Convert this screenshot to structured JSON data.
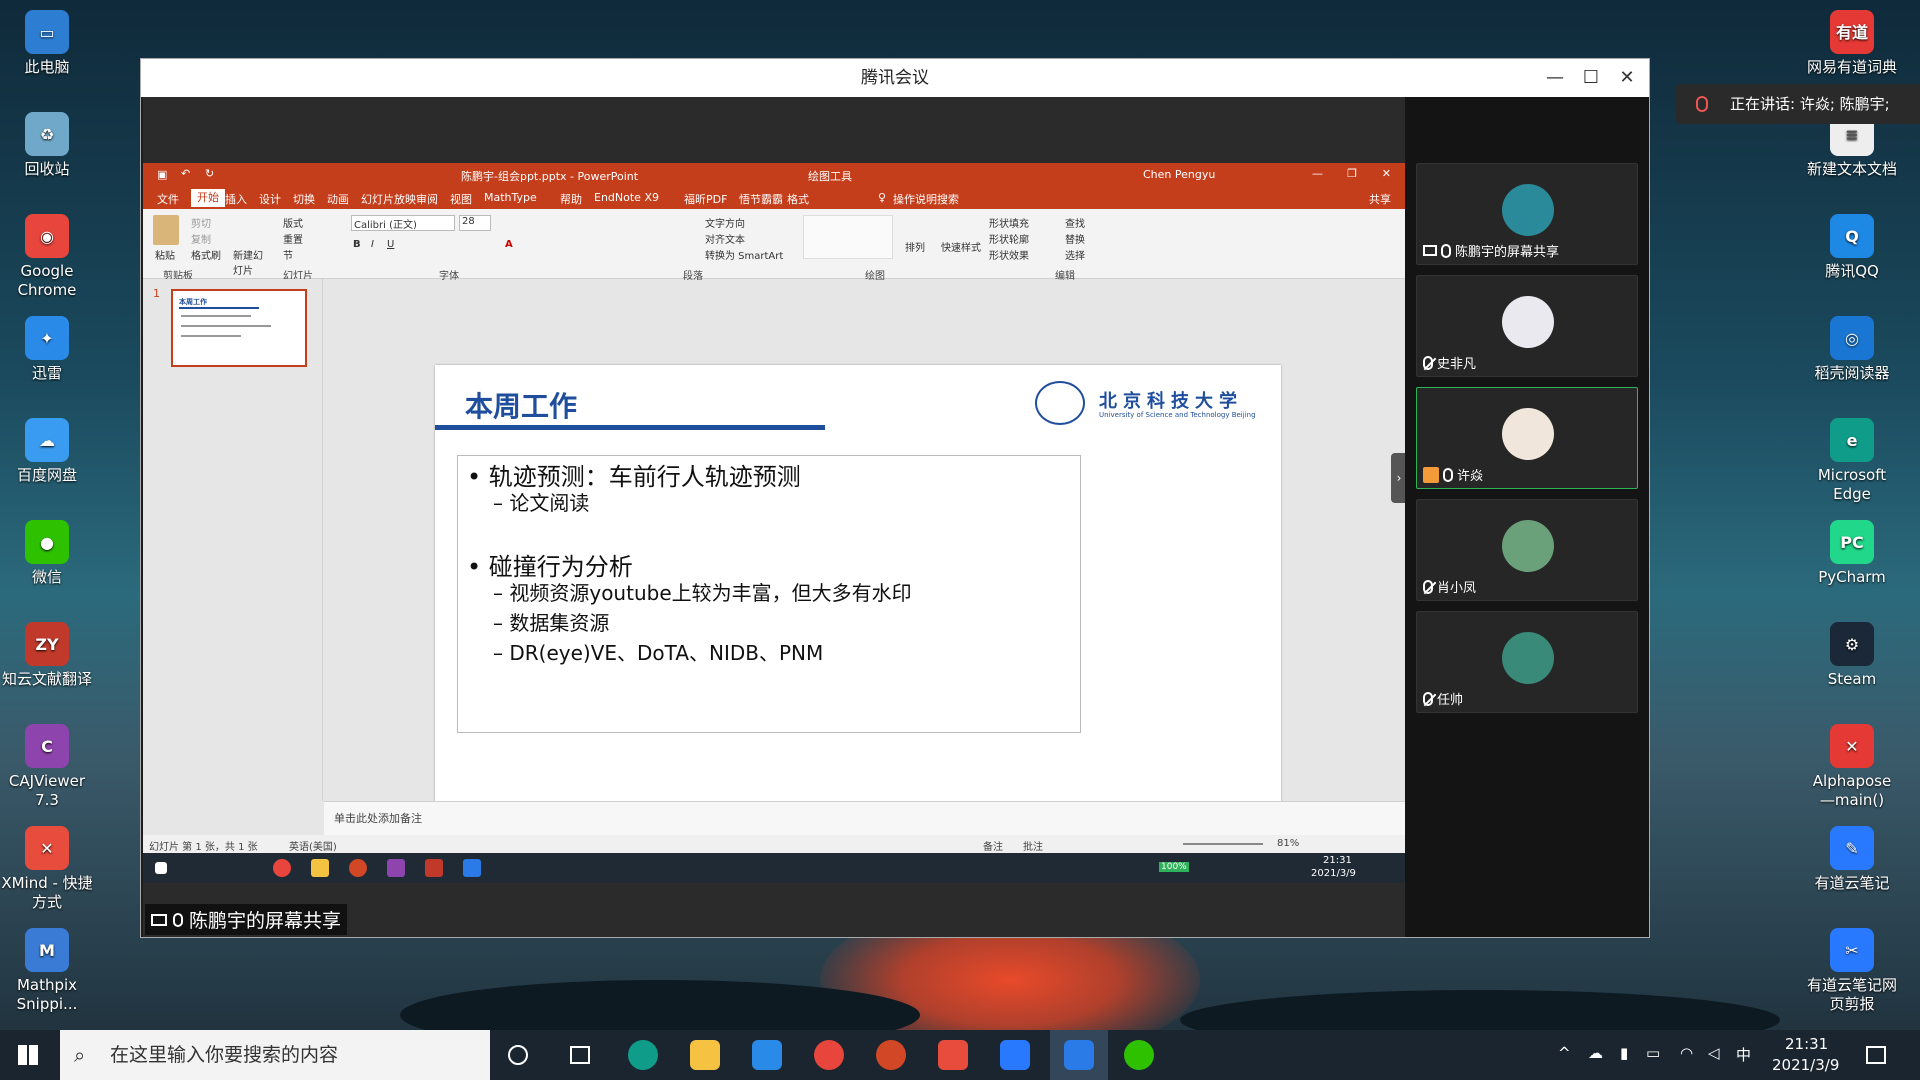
{
  "desktop": {
    "left_icons": [
      {
        "label": "此电脑",
        "color": "#2d7dd2",
        "glyph": "▭"
      },
      {
        "label": "回收站",
        "color": "#6fa8c8",
        "glyph": "♻"
      },
      {
        "label": "Google Chrome",
        "color": "#e8453c",
        "glyph": "◉"
      },
      {
        "label": "迅雷",
        "color": "#2a8ae8",
        "glyph": "✦"
      },
      {
        "label": "百度网盘",
        "color": "#3a9cf0",
        "glyph": "☁"
      },
      {
        "label": "微信",
        "color": "#2dc100",
        "glyph": "●"
      },
      {
        "label": "知云文献翻译",
        "color": "#c0392b",
        "glyph": "ZY"
      },
      {
        "label": "CAJViewer 7.3",
        "color": "#8e44ad",
        "glyph": "C"
      },
      {
        "label": "XMind - 快捷方式",
        "color": "#e74c3c",
        "glyph": "✕"
      },
      {
        "label": "Mathpix Snippi...",
        "color": "#3a7bd5",
        "glyph": "M"
      }
    ],
    "right_icons": [
      {
        "label": "网易有道词典",
        "color": "#e53935",
        "glyph": "有道"
      },
      {
        "label": "新建文本文档",
        "color": "#eeeeee",
        "glyph": "≡"
      },
      {
        "label": "腾讯QQ",
        "color": "#1e88e5",
        "glyph": "Q"
      },
      {
        "label": "稻壳阅读器",
        "color": "#1976d2",
        "glyph": "◎"
      },
      {
        "label": "Microsoft Edge",
        "color": "#0f9d8a",
        "glyph": "e"
      },
      {
        "label": "PyCharm",
        "color": "#21d789",
        "glyph": "PC"
      },
      {
        "label": "Steam",
        "color": "#1b2838",
        "glyph": "⚙"
      },
      {
        "label": "Alphapose —main()",
        "color": "#e53935",
        "glyph": "✕"
      },
      {
        "label": "有道云笔记",
        "color": "#2979ff",
        "glyph": "✎"
      },
      {
        "label": "有道云笔记网页剪报",
        "color": "#2979ff",
        "glyph": "✂"
      }
    ]
  },
  "speaking_banner": "正在讲话: 许焱; 陈鹏宇;",
  "meeting": {
    "title": "腾讯会议",
    "share_label": "陈鹏宇的屏幕共享",
    "participants": [
      {
        "name": "陈鹏宇的屏幕共享",
        "mic": "on",
        "share": true,
        "color": "#2a8a9a"
      },
      {
        "name": "史非凡",
        "mic": "off",
        "share": false,
        "color": "#e9e9ef"
      },
      {
        "name": "许焱",
        "mic": "on",
        "share": false,
        "active": true,
        "color": "#f0e6dc"
      },
      {
        "name": "肖小凤",
        "mic": "off",
        "share": false,
        "color": "#6aa07a"
      },
      {
        "name": "任帅",
        "mic": "off",
        "share": false,
        "color": "#3a8a7a"
      }
    ]
  },
  "ppt": {
    "filename": "陈鹏宇-组会ppt.pptx - PowerPoint",
    "context_tool": "绘图工具",
    "user": "Chen Pengyu",
    "tabs": [
      "文件",
      "开始",
      "插入",
      "设计",
      "切换",
      "动画",
      "幻灯片放映",
      "审阅",
      "视图",
      "MathType",
      "帮助",
      "EndNote X9",
      "福昕PDF",
      "悟节霸霸",
      "格式"
    ],
    "tell_me": "操作说明搜索",
    "share_btn": "共享",
    "font_name": "Calibri (正文)",
    "font_size": "28",
    "groups": [
      "剪贴板",
      "幻灯片",
      "字体",
      "段落",
      "绘图",
      "编辑"
    ],
    "ribbon_items": {
      "paste": "粘贴",
      "cut": "剪切",
      "copy": "复制",
      "format_painter": "格式刷",
      "new_slide": "新建幻灯片",
      "layout": "版式",
      "reset": "重置",
      "section": "节",
      "text_direction": "文字方向",
      "align_text": "对齐文本",
      "smartart": "转换为 SmartArt",
      "arrange": "排列",
      "quick_styles": "快速样式",
      "shape_fill": "形状填充",
      "shape_outline": "形状轮廓",
      "shape_effects": "形状效果",
      "find": "查找",
      "replace": "替换",
      "select": "选择"
    },
    "slide": {
      "title": "本周工作",
      "logo_cn": "北京科技大学",
      "logo_en": "University of Science and Technology Beijing",
      "bullets": [
        {
          "level": 1,
          "text": "轨迹预测：车前行人轨迹预测"
        },
        {
          "level": 2,
          "text": "论文阅读"
        },
        {
          "level": 0,
          "text": ""
        },
        {
          "level": 1,
          "text": "碰撞行为分析"
        },
        {
          "level": 2,
          "text": "视频资源youtube上较为丰富，但大多有水印"
        },
        {
          "level": 2,
          "text": "数据集资源"
        },
        {
          "level": 2,
          "text": "DR(eye)VE、DoTA、NIDB、PNM"
        }
      ],
      "page_number": "1"
    },
    "thumb_number": "1",
    "notes_placeholder": "单击此处添加备注",
    "status_left": "幻灯片 第 1 张，共 1 张",
    "status_lang": "英语(美国)",
    "status_notes": "备注",
    "status_comments": "批注",
    "zoom": "81%",
    "inner_time": "21:31",
    "inner_date": "2021/3/9",
    "battery": "100%"
  },
  "taskbar": {
    "search_placeholder": "在这里输入你要搜索的内容",
    "time": "21:31",
    "date": "2021/3/9",
    "ime": "中"
  }
}
